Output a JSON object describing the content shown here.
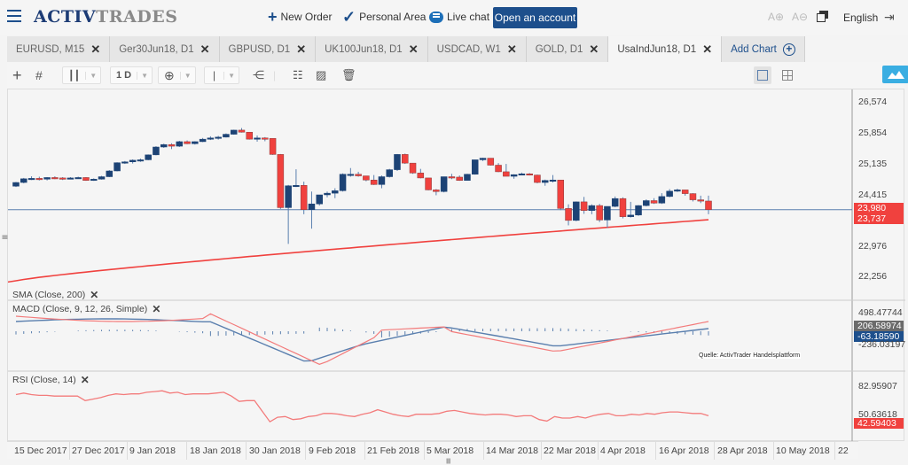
{
  "header": {
    "brand_a": "ACTIV",
    "brand_b": "TRADES",
    "nav": [
      {
        "label": "New Order",
        "icon": "plus-icon"
      },
      {
        "label": "Personal Area",
        "icon": "checkmark-icon"
      },
      {
        "label": "Live chat",
        "icon": "chat-bubble-icon"
      }
    ],
    "cta": "Open an account",
    "font_up_icon": "A⊕",
    "font_down_icon": "A⊖",
    "language": "English"
  },
  "tabs": [
    {
      "label": "EURUSD, M15",
      "active": false
    },
    {
      "label": "Ger30Jun18, D1",
      "active": false
    },
    {
      "label": "GBPUSD, D1",
      "active": false
    },
    {
      "label": "UK100Jun18, D1",
      "active": false
    },
    {
      "label": "USDCAD, W1",
      "active": false
    },
    {
      "label": "GOLD, D1",
      "active": false
    },
    {
      "label": "UsaIndJun18, D1",
      "active": true
    }
  ],
  "add_chart": "Add Chart",
  "close_glyph": "✕",
  "toolbar": {
    "timeframe": "1 D"
  },
  "indicators": {
    "sma": "SMA  (Close, 200)",
    "macd": "MACD  (Close, 9, 12, 26, Simple)",
    "rsi": "RSI  (Close, 14)"
  },
  "price_axis": [
    "26,574",
    "25,854",
    "25,135",
    "24,415",
    "22,976",
    "22,256"
  ],
  "price_badges": {
    "last": "23,980",
    "sma": "23,737",
    "last_color": "#f0413e",
    "sma_color": "#f0413e"
  },
  "macd_axis": [
    "498.47744",
    "-236.03197"
  ],
  "macd_badges": {
    "macd": "206.58974",
    "signal": "-63.18590",
    "macd_color": "#6b6b6b",
    "signal_color": "#1d4f8c"
  },
  "rsi_axis": [
    "82.95907",
    "50.63618"
  ],
  "rsi_badge": {
    "value": "42.59403",
    "color": "#f0413e"
  },
  "source_note": "Quelle: ActivTrader Handelsplattform",
  "date_axis": [
    "15 Dec 2017",
    "27 Dec 2017",
    "9 Jan 2018",
    "18 Jan 2018",
    "30 Jan 2018",
    "9 Feb 2018",
    "21 Feb 2018",
    "5 Mar 2018",
    "14 Mar 2018",
    "22 Mar 2018",
    "4 Apr 2018",
    "16 Apr 2018",
    "28 Apr 2018",
    "10 May 2018",
    "22"
  ],
  "colors": {
    "bull": "#1d4375",
    "bear": "#f0413e",
    "sma": "#f0413e",
    "macd": "#5a7fae",
    "signal": "#f37b7b",
    "rsi": "#f37b7b",
    "brand": "#1d4f8c"
  },
  "chart_data": {
    "type": "candlestick",
    "symbol": "UsaIndJun18, D1",
    "ylim": [
      22256,
      26574
    ],
    "last_price": 23980,
    "candles": [
      [
        24550,
        24650,
        24530,
        24640
      ],
      [
        24640,
        24750,
        24620,
        24730
      ],
      [
        24730,
        24790,
        24700,
        24740
      ],
      [
        24740,
        24780,
        24690,
        24720
      ],
      [
        24720,
        24770,
        24690,
        24760
      ],
      [
        24760,
        24790,
        24720,
        24750
      ],
      [
        24750,
        24770,
        24700,
        24740
      ],
      [
        24740,
        24770,
        24720,
        24750
      ],
      [
        24750,
        24780,
        24730,
        24760
      ],
      [
        24760,
        24770,
        24680,
        24690
      ],
      [
        24690,
        24740,
        24680,
        24720
      ],
      [
        24720,
        24800,
        24710,
        24780
      ],
      [
        24780,
        24940,
        24770,
        24920
      ],
      [
        24920,
        25130,
        24910,
        25120
      ],
      [
        25120,
        25160,
        25090,
        25140
      ],
      [
        25140,
        25200,
        25100,
        25180
      ],
      [
        25180,
        25220,
        25140,
        25190
      ],
      [
        25190,
        25320,
        25180,
        25310
      ],
      [
        25310,
        25520,
        25300,
        25500
      ],
      [
        25500,
        25580,
        25480,
        25560
      ],
      [
        25560,
        25590,
        25450,
        25520
      ],
      [
        25520,
        25650,
        25500,
        25630
      ],
      [
        25630,
        25660,
        25570,
        25580
      ],
      [
        25580,
        25640,
        25560,
        25630
      ],
      [
        25630,
        25720,
        25620,
        25690
      ],
      [
        25690,
        25760,
        25670,
        25720
      ],
      [
        25720,
        25770,
        25680,
        25740
      ],
      [
        25740,
        25830,
        25730,
        25810
      ],
      [
        25810,
        25920,
        25800,
        25910
      ],
      [
        25910,
        25960,
        25850,
        25860
      ],
      [
        25860,
        25850,
        25680,
        25690
      ],
      [
        25690,
        25780,
        25630,
        25720
      ],
      [
        25720,
        25740,
        25640,
        25710
      ],
      [
        25710,
        25700,
        25310,
        25320
      ],
      [
        25320,
        25330,
        24000,
        24030
      ],
      [
        24030,
        24580,
        23150,
        24560
      ],
      [
        24560,
        24960,
        24530,
        24570
      ],
      [
        24570,
        24660,
        23870,
        23980
      ],
      [
        23980,
        24420,
        23520,
        24120
      ],
      [
        24120,
        24340,
        24080,
        24340
      ],
      [
        24340,
        24420,
        24280,
        24380
      ],
      [
        24380,
        24500,
        24260,
        24440
      ],
      [
        24440,
        24860,
        24420,
        24840
      ],
      [
        24840,
        24990,
        24780,
        24840
      ],
      [
        24840,
        24900,
        24780,
        24800
      ],
      [
        24800,
        24800,
        24670,
        24700
      ],
      [
        24700,
        24820,
        24580,
        24590
      ],
      [
        24590,
        24810,
        24500,
        24780
      ],
      [
        24780,
        24970,
        24760,
        24950
      ],
      [
        24950,
        25330,
        24920,
        25320
      ],
      [
        25320,
        25340,
        25090,
        25110
      ],
      [
        25110,
        25110,
        24850,
        24870
      ],
      [
        24870,
        24970,
        24740,
        24750
      ],
      [
        24750,
        24750,
        24450,
        24460
      ],
      [
        24460,
        24480,
        24330,
        24420
      ],
      [
        24420,
        24780,
        24400,
        24780
      ],
      [
        24780,
        24850,
        24720,
        24770
      ],
      [
        24770,
        24810,
        24680,
        24690
      ],
      [
        24690,
        24850,
        24690,
        24840
      ],
      [
        24840,
        25190,
        24830,
        25190
      ],
      [
        25190,
        25240,
        25160,
        25230
      ],
      [
        25230,
        25230,
        25050,
        25060
      ],
      [
        25060,
        25110,
        24890,
        24900
      ],
      [
        24900,
        25090,
        24790,
        24790
      ],
      [
        24790,
        24840,
        24730,
        24830
      ],
      [
        24830,
        24880,
        24830,
        24850
      ],
      [
        24850,
        24870,
        24810,
        24820
      ],
      [
        24820,
        24830,
        24620,
        24640
      ],
      [
        24640,
        24710,
        24560,
        24690
      ],
      [
        24690,
        24820,
        24640,
        24700
      ],
      [
        24700,
        24700,
        23970,
        24010
      ],
      [
        24010,
        24110,
        23600,
        23720
      ],
      [
        23720,
        24180,
        23700,
        24170
      ],
      [
        24170,
        24290,
        23880,
        23960
      ],
      [
        23960,
        24110,
        23870,
        24080
      ],
      [
        24080,
        24120,
        23680,
        23730
      ],
      [
        23730,
        24060,
        23540,
        24060
      ],
      [
        24060,
        24300,
        24040,
        24250
      ],
      [
        24250,
        24280,
        23770,
        23810
      ],
      [
        23810,
        24170,
        23790,
        23850
      ]
    ],
    "candles_tail": [
      [
        23850,
        24090,
        23830,
        24080
      ],
      [
        24080,
        24230,
        24060,
        24200
      ],
      [
        24200,
        24260,
        24120,
        24140
      ],
      [
        24140,
        24380,
        24120,
        24300
      ],
      [
        24300,
        24480,
        24280,
        24430
      ],
      [
        24430,
        24490,
        24410,
        24460
      ],
      [
        24460,
        24460,
        24320,
        24370
      ],
      [
        24370,
        24380,
        24180,
        24220
      ],
      [
        24220,
        24320,
        24140,
        24190
      ],
      [
        24190,
        24320,
        23870,
        23980
      ]
    ],
    "sma200": {
      "start": 22256,
      "end": 23737
    },
    "macd": {
      "ylim": [
        -360,
        560
      ],
      "histogram_note": "histogram bars around zero line"
    },
    "rsi": {
      "ylim": [
        20,
        95
      ],
      "values": [
        78,
        80,
        78,
        77,
        77,
        76,
        76,
        76,
        76,
        70,
        72,
        74,
        77,
        79,
        78,
        79,
        79,
        81,
        82,
        83,
        80,
        81,
        78,
        79,
        79,
        79,
        80,
        81,
        76,
        69,
        70,
        70,
        56,
        42,
        48,
        49,
        45,
        46,
        49,
        50,
        53,
        53,
        52,
        50,
        49,
        52,
        54,
        58,
        55,
        52,
        50,
        49,
        52,
        52,
        52,
        53,
        56,
        57,
        55,
        53,
        52,
        51,
        52,
        52,
        51,
        49,
        50,
        50,
        45,
        43,
        49,
        47,
        47,
        49,
        47,
        50,
        52,
        53,
        50,
        50,
        52,
        51,
        53,
        52,
        54,
        55,
        55,
        54,
        53,
        53,
        50
      ]
    }
  }
}
